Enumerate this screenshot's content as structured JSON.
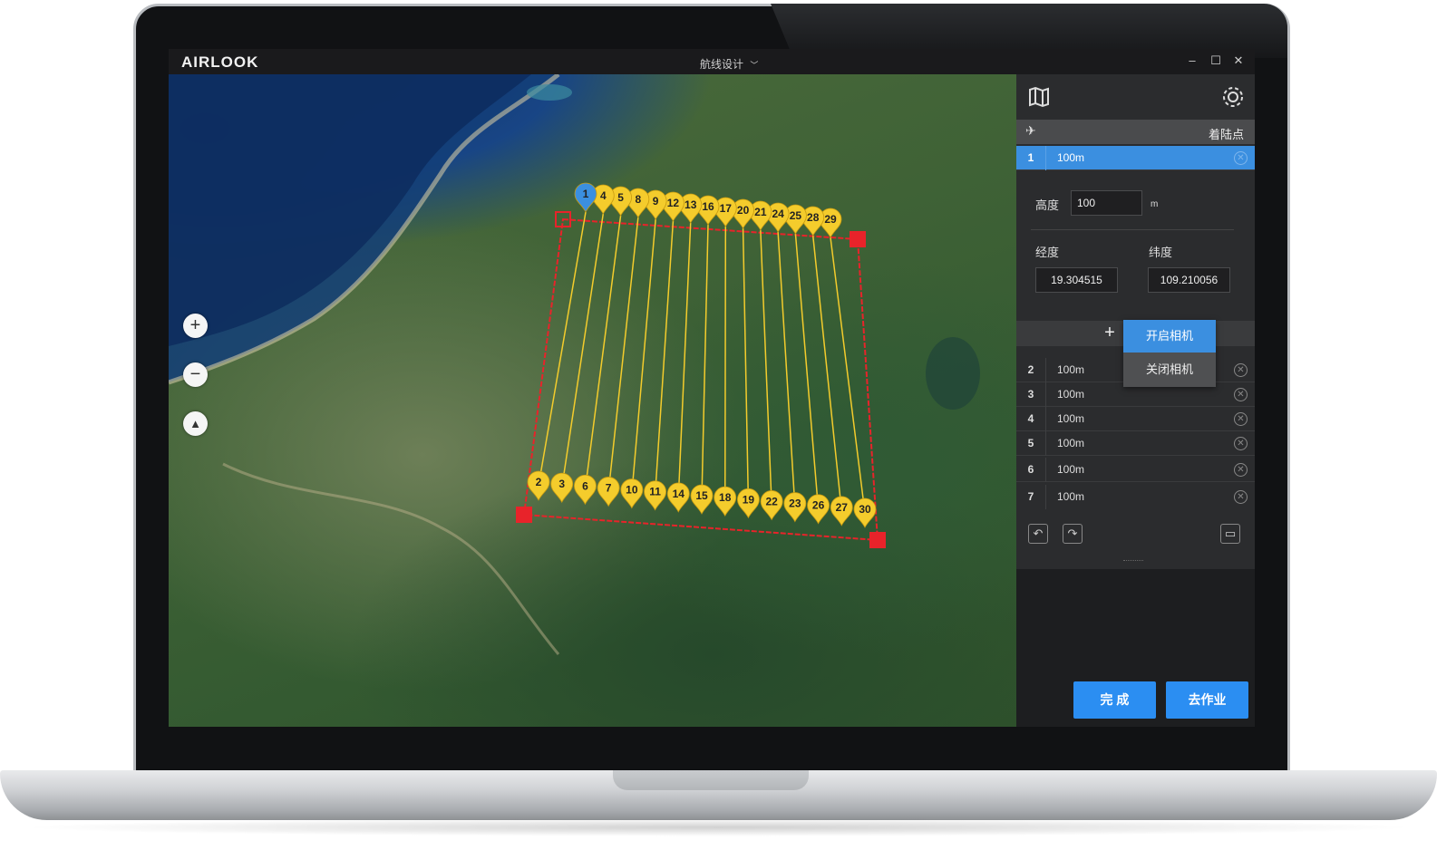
{
  "app": {
    "logo": "AIRLOOK",
    "title": "航线设计",
    "title_chevron": "chevron-down-icon",
    "window_controls": [
      "–",
      "☐",
      "✕"
    ]
  },
  "map": {
    "controls": {
      "zoom_in": "+",
      "zoom_out": "−",
      "compass": "▲"
    },
    "waypoints_top": [
      "1",
      "4",
      "5",
      "8",
      "9",
      "12",
      "13",
      "16",
      "17",
      "20",
      "21",
      "24",
      "25",
      "28",
      "29"
    ],
    "waypoints_bottom": [
      "2",
      "3",
      "6",
      "7",
      "10",
      "11",
      "14",
      "15",
      "18",
      "19",
      "22",
      "23",
      "26",
      "27",
      "30"
    ],
    "colors": {
      "route": "#f4cc2c",
      "boundary": "#e8232a",
      "home": "#3b8fe0"
    }
  },
  "panel": {
    "landing_label": "着陆点",
    "selected_row": {
      "num": "1",
      "alt": "100m"
    },
    "height_label": "高度",
    "height_value": "100",
    "height_unit": "m",
    "lon_label": "经度",
    "lat_label": "纬度",
    "lon_value": "19.304515",
    "lat_value": "109.210056",
    "add_label": "+",
    "camera_on": "开启相机",
    "camera_off": "关闭相机",
    "rows": [
      {
        "num": "2",
        "alt": "100m"
      },
      {
        "num": "3",
        "alt": "100m"
      },
      {
        "num": "4",
        "alt": "100m"
      },
      {
        "num": "5",
        "alt": "100m"
      },
      {
        "num": "6",
        "alt": "100m"
      },
      {
        "num": "7",
        "alt": "100m"
      }
    ],
    "accent": "#3b8fe0"
  },
  "buttons": {
    "finish": "完 成",
    "go": "去作业"
  }
}
